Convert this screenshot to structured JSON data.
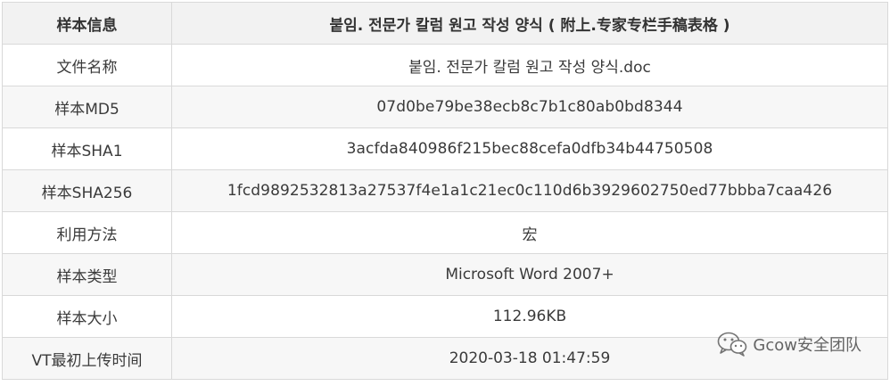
{
  "table": {
    "header": {
      "label": "样本信息",
      "value": "붙임. 전문가 칼럼 원고 작성 양식 ( 附上.专家专栏手稿表格 )"
    },
    "rows": [
      {
        "label": "文件名称",
        "value": "붙임. 전문가 칼럼 원고 작성 양식.doc"
      },
      {
        "label": "样本MD5",
        "value": "07d0be79be38ecb8c7b1c80ab0bd8344"
      },
      {
        "label": "样本SHA1",
        "value": "3acfda840986f215bec88cefa0dfb34b44750508"
      },
      {
        "label": "样本SHA256",
        "value": "1fcd9892532813a27537f4e1a1c21ec0c110d6b3929602750ed77bbba7caa426"
      },
      {
        "label": "利用方法",
        "value": "宏"
      },
      {
        "label": "样本类型",
        "value": "Microsoft Word 2007+"
      },
      {
        "label": "样本大小",
        "value": "112.96KB"
      },
      {
        "label": "VT最初上传时间",
        "value": "2020-03-18 01:47:59"
      }
    ]
  },
  "watermark": {
    "icon": "wechat-icon",
    "text": "Gcow安全团队"
  }
}
